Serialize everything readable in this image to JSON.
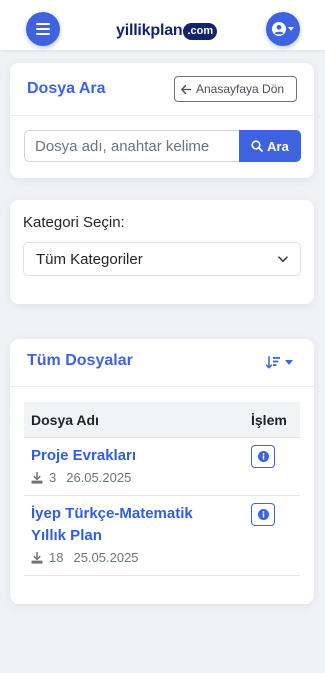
{
  "header": {
    "logo_text": "yillikplan",
    "logo_suffix": ".com",
    "menu_icon": "bars-icon",
    "user_icon": "user-circle-icon"
  },
  "search": {
    "title": "Dosya Ara",
    "home_button": "Anasayfaya Dön",
    "placeholder": "Dosya adı, anahtar kelime",
    "button": "Ara"
  },
  "category": {
    "label": "Kategori Seçin:",
    "selected": "Tüm Kategoriler"
  },
  "files": {
    "title": "Tüm Dosyalar",
    "columns": {
      "name": "Dosya Adı",
      "action": "İşlem"
    },
    "rows": [
      {
        "name": "Proje Evrakları",
        "downloads": "3",
        "date": "26.05.2025"
      },
      {
        "name": "İyep Türkçe-Matematik Yıllık Plan",
        "downloads": "18",
        "date": "25.05.2025"
      }
    ]
  },
  "colors": {
    "primary": "#3f63e0",
    "link": "#2f5fe0",
    "logo": "#14246b",
    "background": "#f1f2f6"
  }
}
